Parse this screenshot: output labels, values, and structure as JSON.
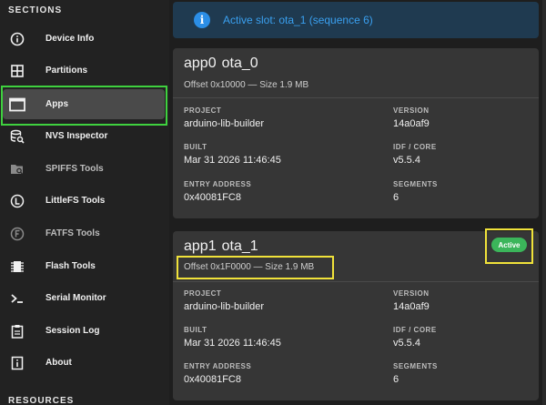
{
  "sidebar": {
    "sections_header": "SECTIONS",
    "resources_header": "RESOURCES",
    "items": [
      {
        "label": "Device Info",
        "icon": "info-circle-icon",
        "active": false,
        "disabled": false
      },
      {
        "label": "Partitions",
        "icon": "grid-icon",
        "active": false,
        "disabled": false
      },
      {
        "label": "Apps",
        "icon": "window-icon",
        "active": true,
        "disabled": false
      },
      {
        "label": "NVS Inspector",
        "icon": "database-search-icon",
        "active": false,
        "disabled": false
      },
      {
        "label": "SPIFFS Tools",
        "icon": "folder-search-icon",
        "active": false,
        "disabled": true
      },
      {
        "label": "LittleFS Tools",
        "icon": "circle-l-icon",
        "active": false,
        "disabled": false
      },
      {
        "label": "FATFS Tools",
        "icon": "circle-f-icon",
        "active": false,
        "disabled": true
      },
      {
        "label": "Flash Tools",
        "icon": "chip-icon",
        "active": false,
        "disabled": false
      },
      {
        "label": "Serial Monitor",
        "icon": "terminal-icon",
        "active": false,
        "disabled": false
      },
      {
        "label": "Session Log",
        "icon": "clipboard-icon",
        "active": false,
        "disabled": false
      },
      {
        "label": "About",
        "icon": "info-square-icon",
        "active": false,
        "disabled": false
      }
    ]
  },
  "banner": {
    "text": "Active slot: ota_1 (sequence 6)",
    "icon": "info-icon",
    "icon_glyph": "i"
  },
  "apps": [
    {
      "slot": "app0",
      "label": "ota_0",
      "subtitle": "Offset 0x10000 — Size 1.9 MB",
      "active": false,
      "fields": {
        "project_label": "PROJECT",
        "project": "arduino-lib-builder",
        "version_label": "VERSION",
        "version": "14a0af9",
        "built_label": "BUILT",
        "built": "Mar 31 2026 11:46:45",
        "idf_label": "IDF / CORE",
        "idf": "v5.5.4",
        "entry_label": "ENTRY ADDRESS",
        "entry": "0x40081FC8",
        "segments_label": "SEGMENTS",
        "segments": "6"
      }
    },
    {
      "slot": "app1",
      "label": "ota_1",
      "subtitle": "Offset 0x1F0000 — Size 1.9 MB",
      "active": true,
      "badge": "Active",
      "fields": {
        "project_label": "PROJECT",
        "project": "arduino-lib-builder",
        "version_label": "VERSION",
        "version": "14a0af9",
        "built_label": "BUILT",
        "built": "Mar 31 2026 11:46:45",
        "idf_label": "IDF / CORE",
        "idf": "v5.5.4",
        "entry_label": "ENTRY ADDRESS",
        "entry": "0x40081FC8",
        "segments_label": "SEGMENTS",
        "segments": "6"
      }
    }
  ],
  "colors": {
    "active_green": "#3bb55a",
    "highlight_green": "#3fd13f",
    "highlight_yellow": "#f0e23a",
    "banner_text": "#3aa0f0"
  }
}
